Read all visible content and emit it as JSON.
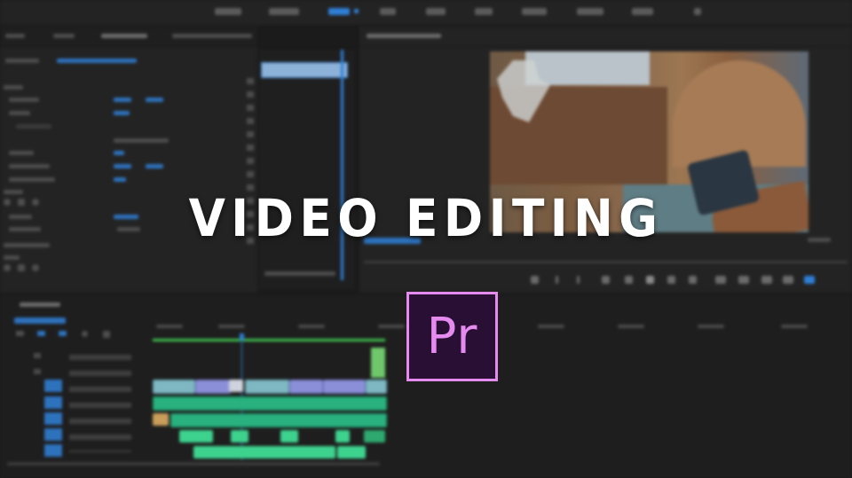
{
  "overlay": {
    "title": "VIDEO EDITING",
    "logo_text": "Pr"
  },
  "colors": {
    "accent_blue": "#2f7fd6",
    "logo_background": "#2a0f35",
    "logo_outline": "#e58bf0",
    "clip_audio_green": "#29b17f",
    "clip_video_purple": "#8b8fd8"
  }
}
